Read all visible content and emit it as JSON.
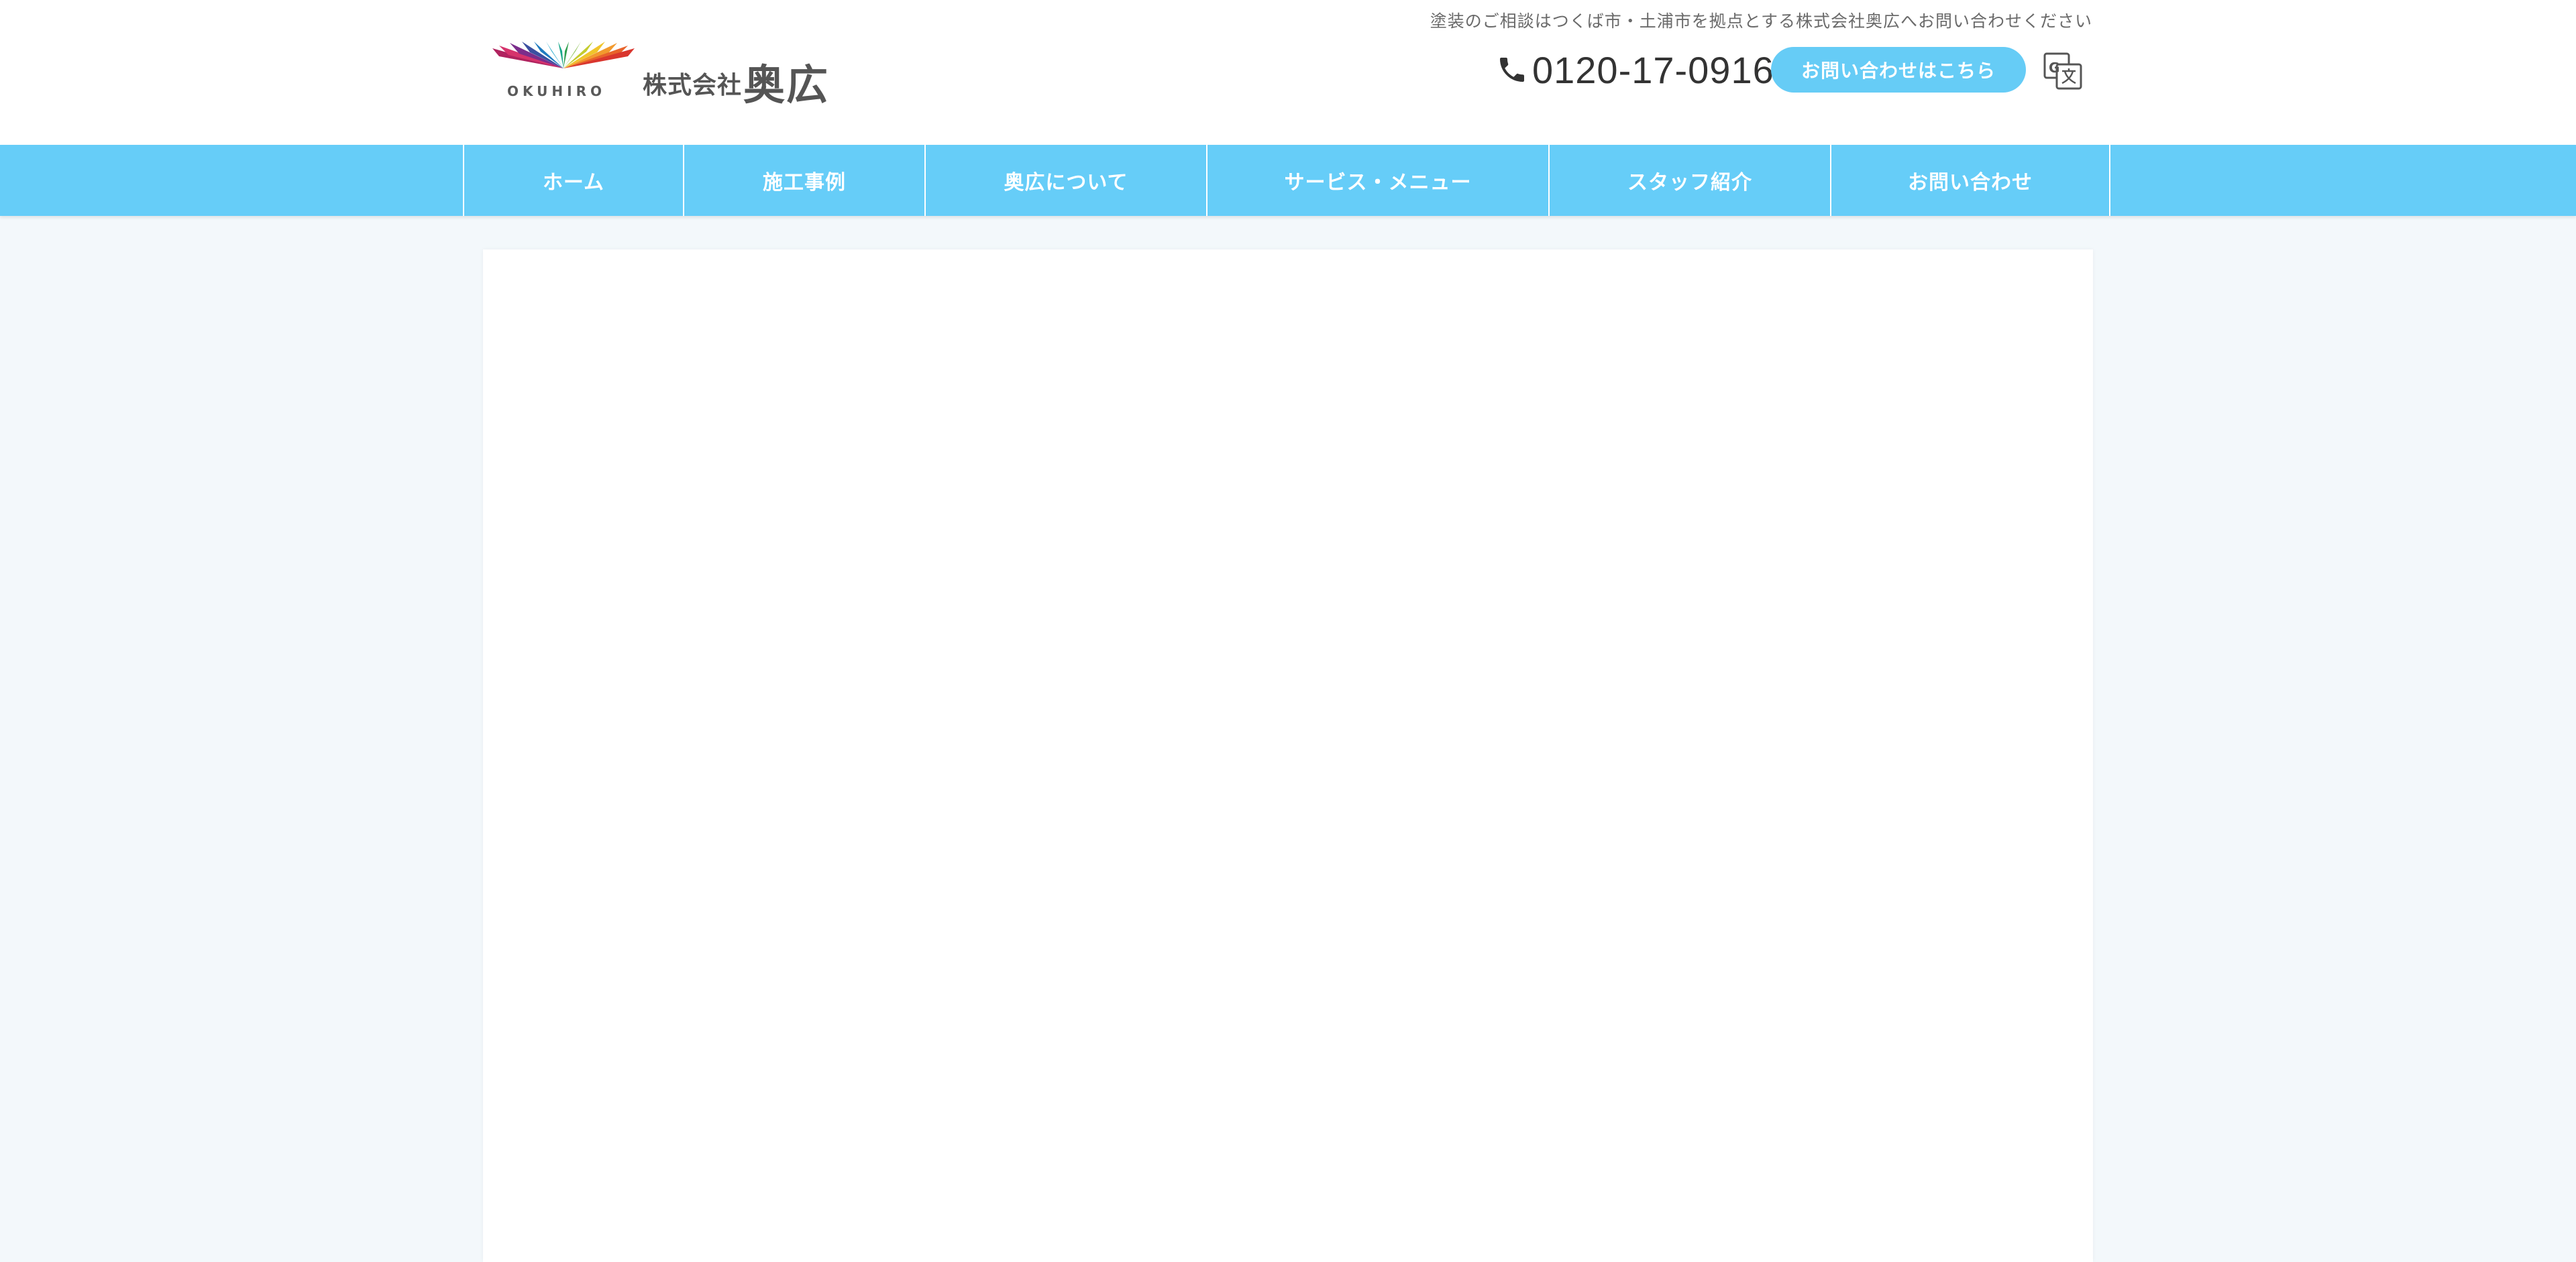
{
  "header": {
    "tagline": "塗装のご相談はつくば市・土浦市を拠点とする株式会社奥広へお問い合わせください",
    "logo": {
      "en": "OKUHIRO",
      "kabushiki": "株式会社",
      "name": "奥広"
    },
    "phone": "0120-17-0916",
    "contact_button": "お問い合わせはこちら",
    "translate_icon": "google-translate-icon"
  },
  "nav": {
    "items": [
      {
        "label": "ホーム"
      },
      {
        "label": "施工事例"
      },
      {
        "label": "奥広について"
      },
      {
        "label": "サービス・メニュー"
      },
      {
        "label": "スタッフ紹介"
      },
      {
        "label": "お問い合わせ"
      }
    ]
  },
  "colors": {
    "accent": "#66cdf8",
    "background": "#f3f8fb",
    "text": "#333333"
  }
}
